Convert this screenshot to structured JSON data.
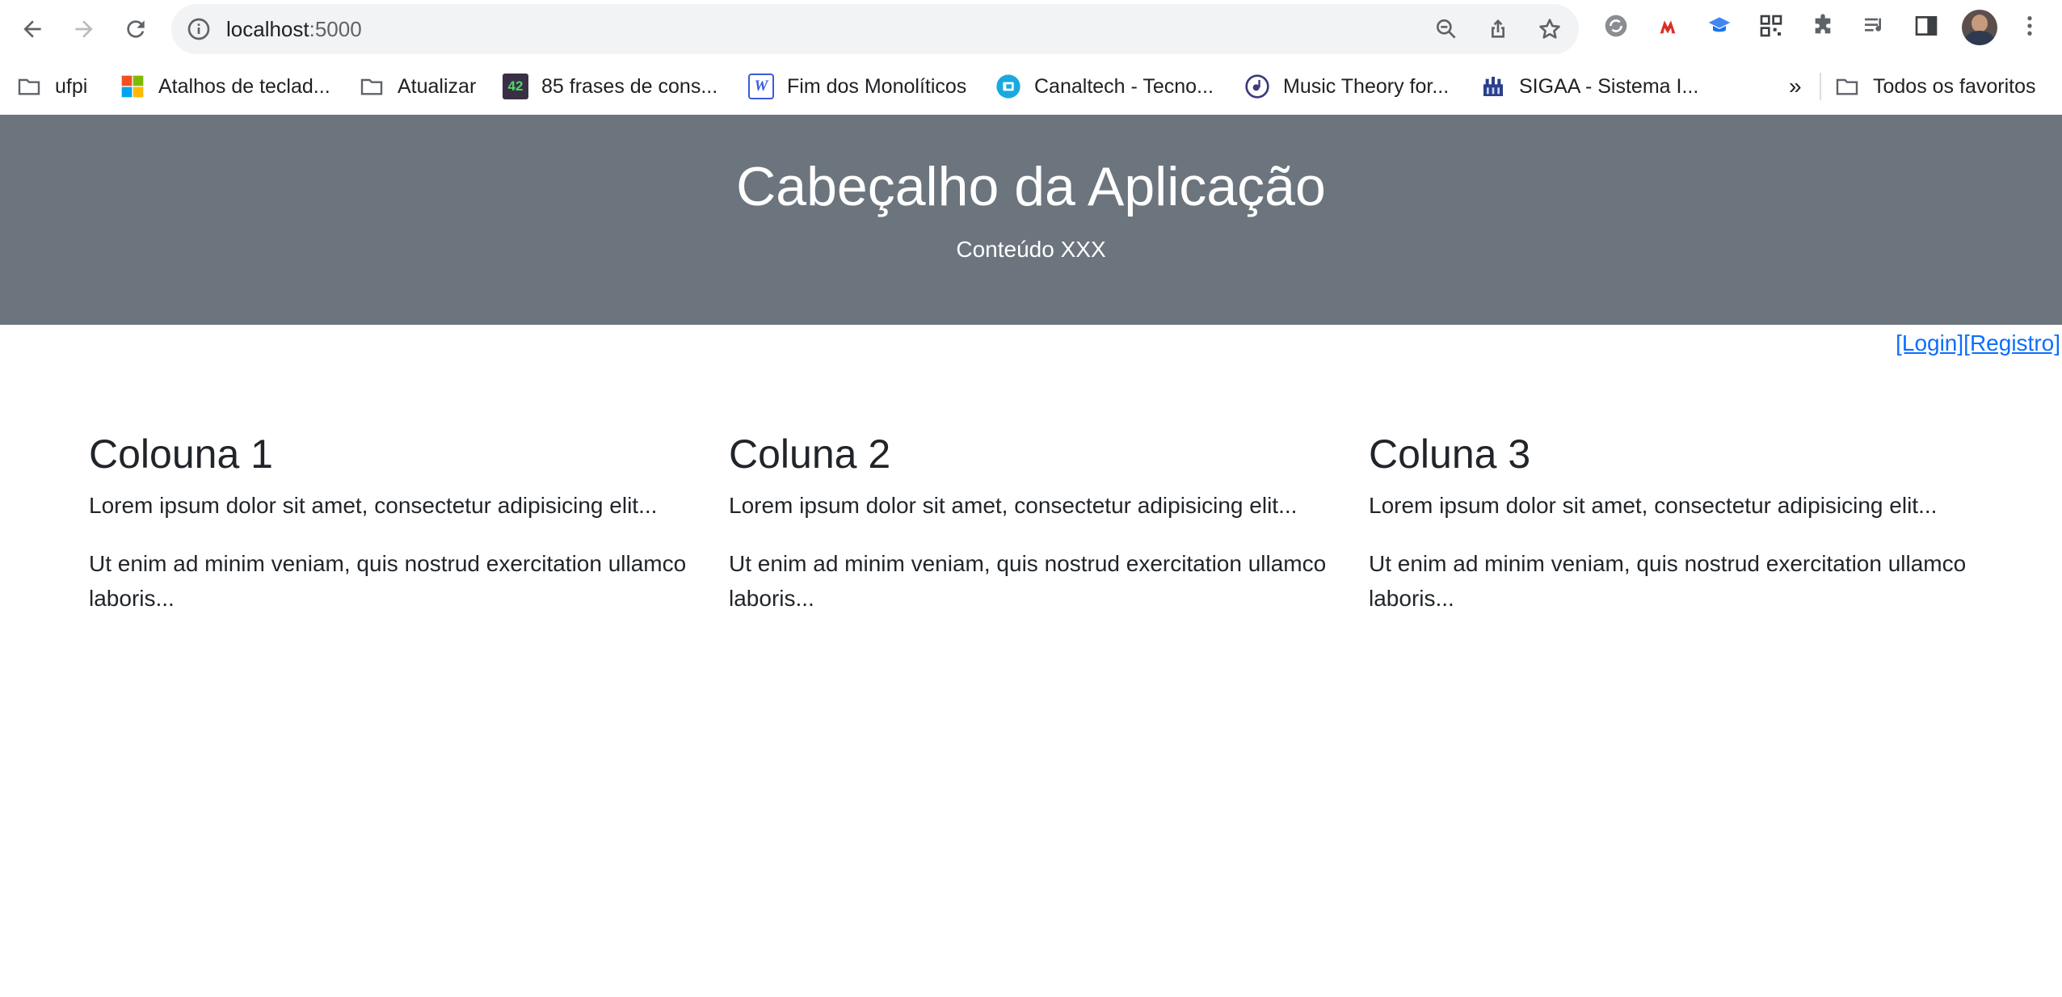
{
  "browser": {
    "url_host": "localhost",
    "url_port": ":5000",
    "bookmarks": [
      {
        "label": "ufpi",
        "icon": "folder-icon"
      },
      {
        "label": "Atalhos de teclad...",
        "icon": "microsoft-icon"
      },
      {
        "label": "Atualizar",
        "icon": "folder-icon"
      },
      {
        "label": "85 frases de cons...",
        "icon": "42-icon",
        "icon_text": "42"
      },
      {
        "label": "Fim dos Monolíticos",
        "icon": "w-icon",
        "icon_text": "W"
      },
      {
        "label": "Canaltech - Tecno...",
        "icon": "canaltech-icon"
      },
      {
        "label": "Music Theory for...",
        "icon": "music-theory-icon"
      },
      {
        "label": "SIGAA - Sistema I...",
        "icon": "sigaa-icon"
      }
    ],
    "more_bookmarks": "»",
    "all_bookmarks": "Todos os favoritos"
  },
  "page": {
    "header_title": "Cabeçalho da Aplicação",
    "header_subtitle": "Conteúdo XXX",
    "login_link": "[Login]",
    "register_link": "[Registro]",
    "columns": [
      {
        "title": "Colouna 1",
        "p1": "Lorem ipsum dolor sit amet, consectetur adipisicing elit...",
        "p2": "Ut enim ad minim veniam, quis nostrud exercitation ullamco laboris..."
      },
      {
        "title": "Coluna 2",
        "p1": "Lorem ipsum dolor sit amet, consectetur adipisicing elit...",
        "p2": "Ut enim ad minim veniam, quis nostrud exercitation ullamco laboris..."
      },
      {
        "title": "Coluna 3",
        "p1": "Lorem ipsum dolor sit amet, consectetur adipisicing elit...",
        "p2": "Ut enim ad minim veniam, quis nostrud exercitation ullamco laboris..."
      }
    ]
  },
  "colors": {
    "header_bg": "#6c757d",
    "link": "#0d6efd",
    "text": "#212529"
  }
}
